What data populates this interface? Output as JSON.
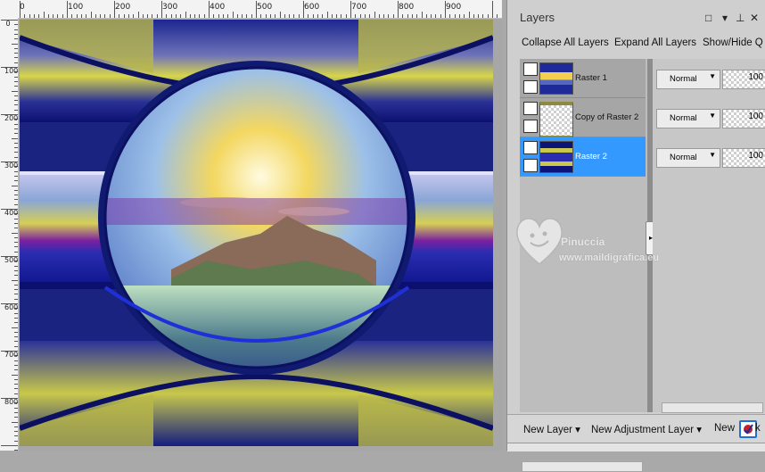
{
  "rulers": {
    "horizontal": [
      "0",
      "100",
      "200",
      "300",
      "400",
      "500",
      "600",
      "700",
      "800",
      "900"
    ],
    "vertical": [
      "0",
      "100",
      "200",
      "300",
      "400",
      "500",
      "600",
      "700",
      "800"
    ]
  },
  "panel": {
    "title": "Layers",
    "controls": {
      "restore": "□",
      "menu": "▾",
      "pin": "⊥",
      "close": "✕"
    },
    "toolbar": {
      "collapse": "Collapse All Layers",
      "expand": "Expand All Layers",
      "show_hide": "Show/Hide Q"
    },
    "layers": [
      {
        "name": "Raster 1",
        "blend": "Normal",
        "opacity": "100",
        "selected": false
      },
      {
        "name": "Copy of Raster 2",
        "blend": "Normal",
        "opacity": "100",
        "selected": false
      },
      {
        "name": "Raster 2",
        "blend": "Normal",
        "opacity": "100",
        "selected": true
      }
    ],
    "bottom": {
      "new_layer": "New Layer",
      "new_adjustment": "New Adjustment Layer",
      "new_mask": "New",
      "mask_tail": "k"
    }
  },
  "watermark": {
    "name": "Pinuccia",
    "site": "www.maildigrafica.eu"
  },
  "colors": {
    "selection": "#3399ff",
    "accent_yellow": "#d9d54a",
    "accent_blue": "#1a2a9e"
  }
}
